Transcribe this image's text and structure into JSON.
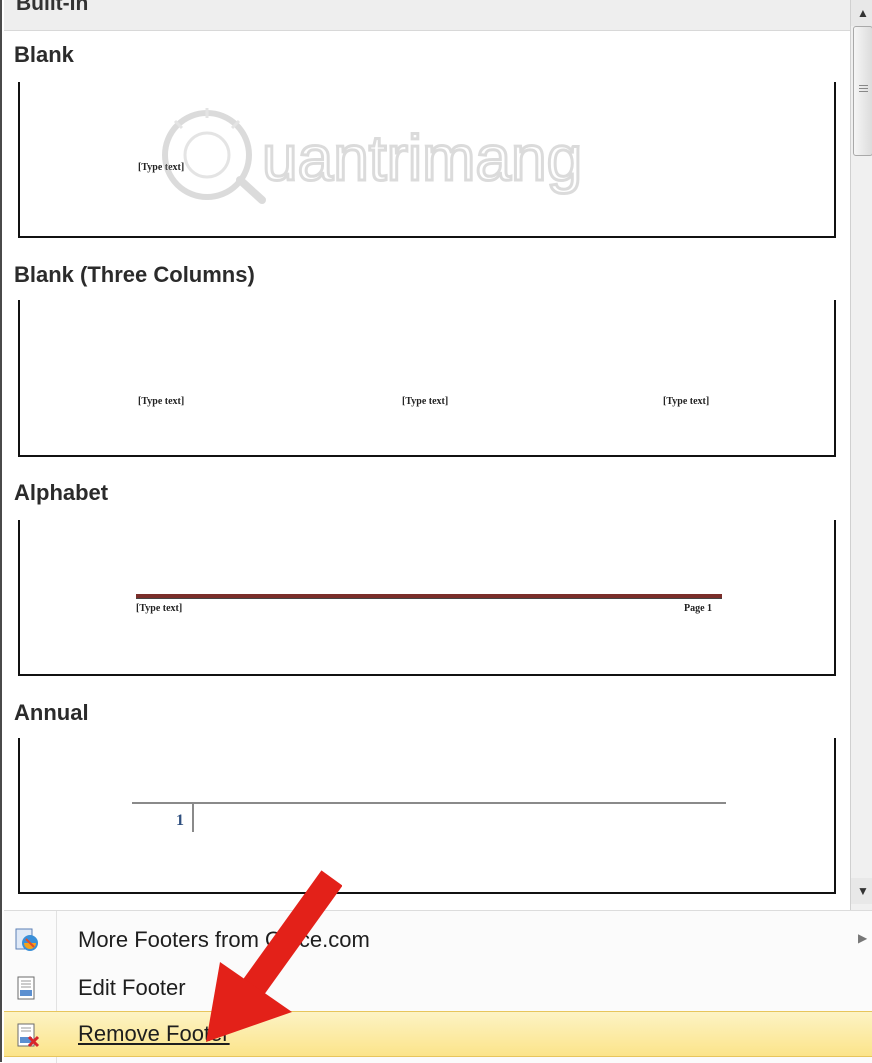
{
  "gallery": {
    "section_header": "Built-In",
    "items": [
      {
        "title": "Blank",
        "preview_texts": [
          "[Type text]"
        ]
      },
      {
        "title": "Blank (Three Columns)",
        "preview_texts": [
          "[Type text]",
          "[Type text]",
          "[Type text]"
        ]
      },
      {
        "title": "Alphabet",
        "preview_texts": [
          "[Type text]",
          "Page 1"
        ],
        "rule_color": "#7a2e2a"
      },
      {
        "title": "Annual",
        "preview_texts": [
          "1"
        ]
      }
    ]
  },
  "menu": {
    "items": [
      {
        "label": "More Footers from Office.com",
        "icon": "office-globe-icon",
        "has_submenu": true
      },
      {
        "label": "Edit Footer",
        "icon": "edit-footer-icon"
      },
      {
        "label": "Remove Footer",
        "icon": "remove-footer-icon",
        "highlighted": true
      }
    ]
  },
  "colors": {
    "highlight": "#fbe48a",
    "annotation_arrow": "#e32119"
  }
}
